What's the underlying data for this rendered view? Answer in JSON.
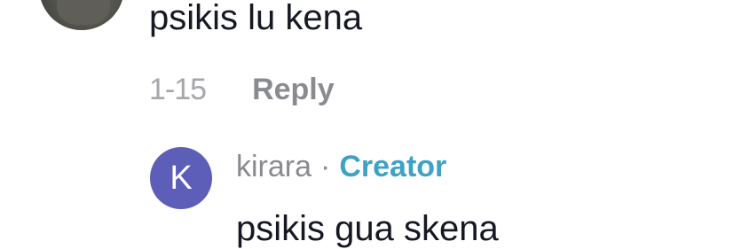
{
  "comment": {
    "text": "psikis lu kena",
    "date": "1-15",
    "reply_label": "Reply"
  },
  "reply": {
    "avatar_initial": "K",
    "avatar_color": "#5d5eb8",
    "username": "kirara",
    "separator": "·",
    "badge": "Creator",
    "badge_color": "#3ea2c6",
    "text": "psikis gua skena"
  }
}
